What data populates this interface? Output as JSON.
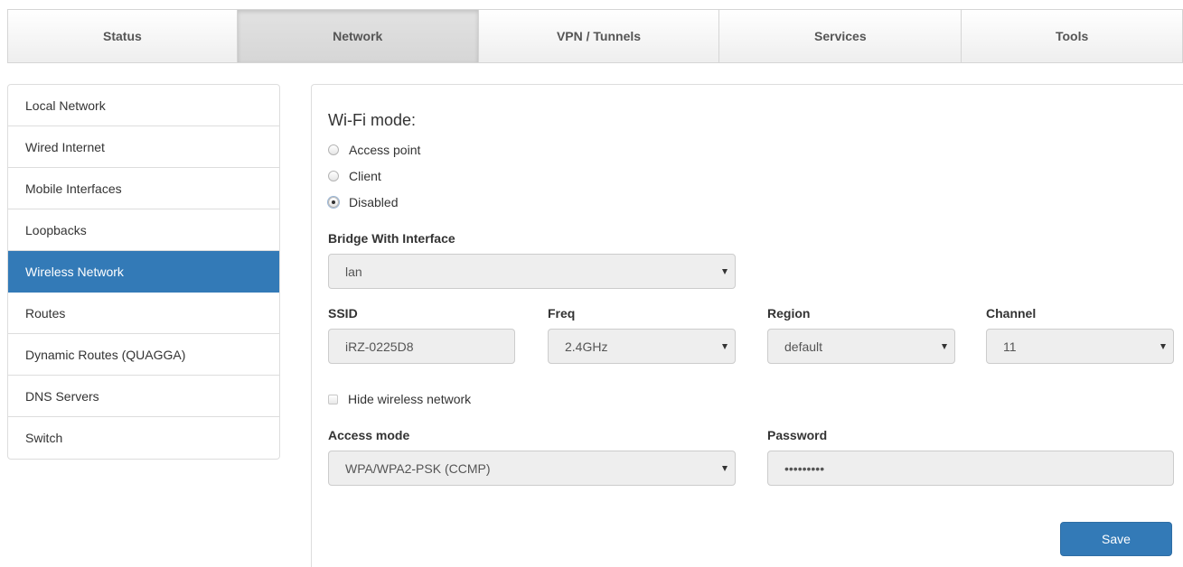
{
  "topnav": {
    "tabs": [
      {
        "label": "Status"
      },
      {
        "label": "Network"
      },
      {
        "label": "VPN / Tunnels"
      },
      {
        "label": "Services"
      },
      {
        "label": "Tools"
      }
    ],
    "active_tab": "Network"
  },
  "sidebar": {
    "items": [
      {
        "label": "Local Network"
      },
      {
        "label": "Wired Internet"
      },
      {
        "label": "Mobile Interfaces"
      },
      {
        "label": "Loopbacks"
      },
      {
        "label": "Wireless Network"
      },
      {
        "label": "Routes"
      },
      {
        "label": "Dynamic Routes (QUAGGA)"
      },
      {
        "label": "DNS Servers"
      },
      {
        "label": "Switch"
      }
    ],
    "active_item": "Wireless Network"
  },
  "form": {
    "wifi_mode_title": "Wi-Fi mode:",
    "modes": [
      {
        "label": "Access point",
        "checked": false
      },
      {
        "label": "Client",
        "checked": false
      },
      {
        "label": "Disabled",
        "checked": true
      }
    ],
    "bridge": {
      "label": "Bridge With Interface",
      "value": "lan"
    },
    "ssid": {
      "label": "SSID",
      "value": "iRZ-0225D8"
    },
    "freq": {
      "label": "Freq",
      "value": "2.4GHz"
    },
    "region": {
      "label": "Region",
      "value": "default"
    },
    "channel": {
      "label": "Channel",
      "value": "11"
    },
    "hide_network": {
      "label": "Hide wireless network",
      "checked": false
    },
    "access_mode": {
      "label": "Access mode",
      "value": "WPA/WPA2-PSK (CCMP)"
    },
    "password": {
      "label": "Password",
      "value": "•••••••••"
    },
    "save_label": "Save"
  },
  "colors": {
    "accent": "#337ab7",
    "field_bg": "#eeeeee",
    "border": "#dddddd"
  }
}
